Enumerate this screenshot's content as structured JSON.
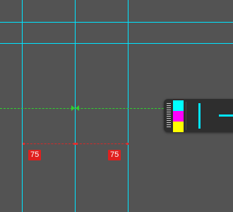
{
  "colors": {
    "guide": "#00e5ff",
    "smart_guide": "#2fd12f",
    "measure": "#e0201e",
    "canvas_bg": "#535353",
    "panel_bg": "#2e2e2e"
  },
  "measurements": {
    "left_gap": "75",
    "right_gap": "75"
  },
  "panel": {
    "swatches": [
      {
        "name": "cyan",
        "color": "#00ffff"
      },
      {
        "name": "magenta",
        "color": "#ff00ff"
      },
      {
        "name": "yellow",
        "color": "#ffff00"
      }
    ],
    "tools": [
      "vertical-guide-icon",
      "horizontal-guide-icon"
    ]
  }
}
